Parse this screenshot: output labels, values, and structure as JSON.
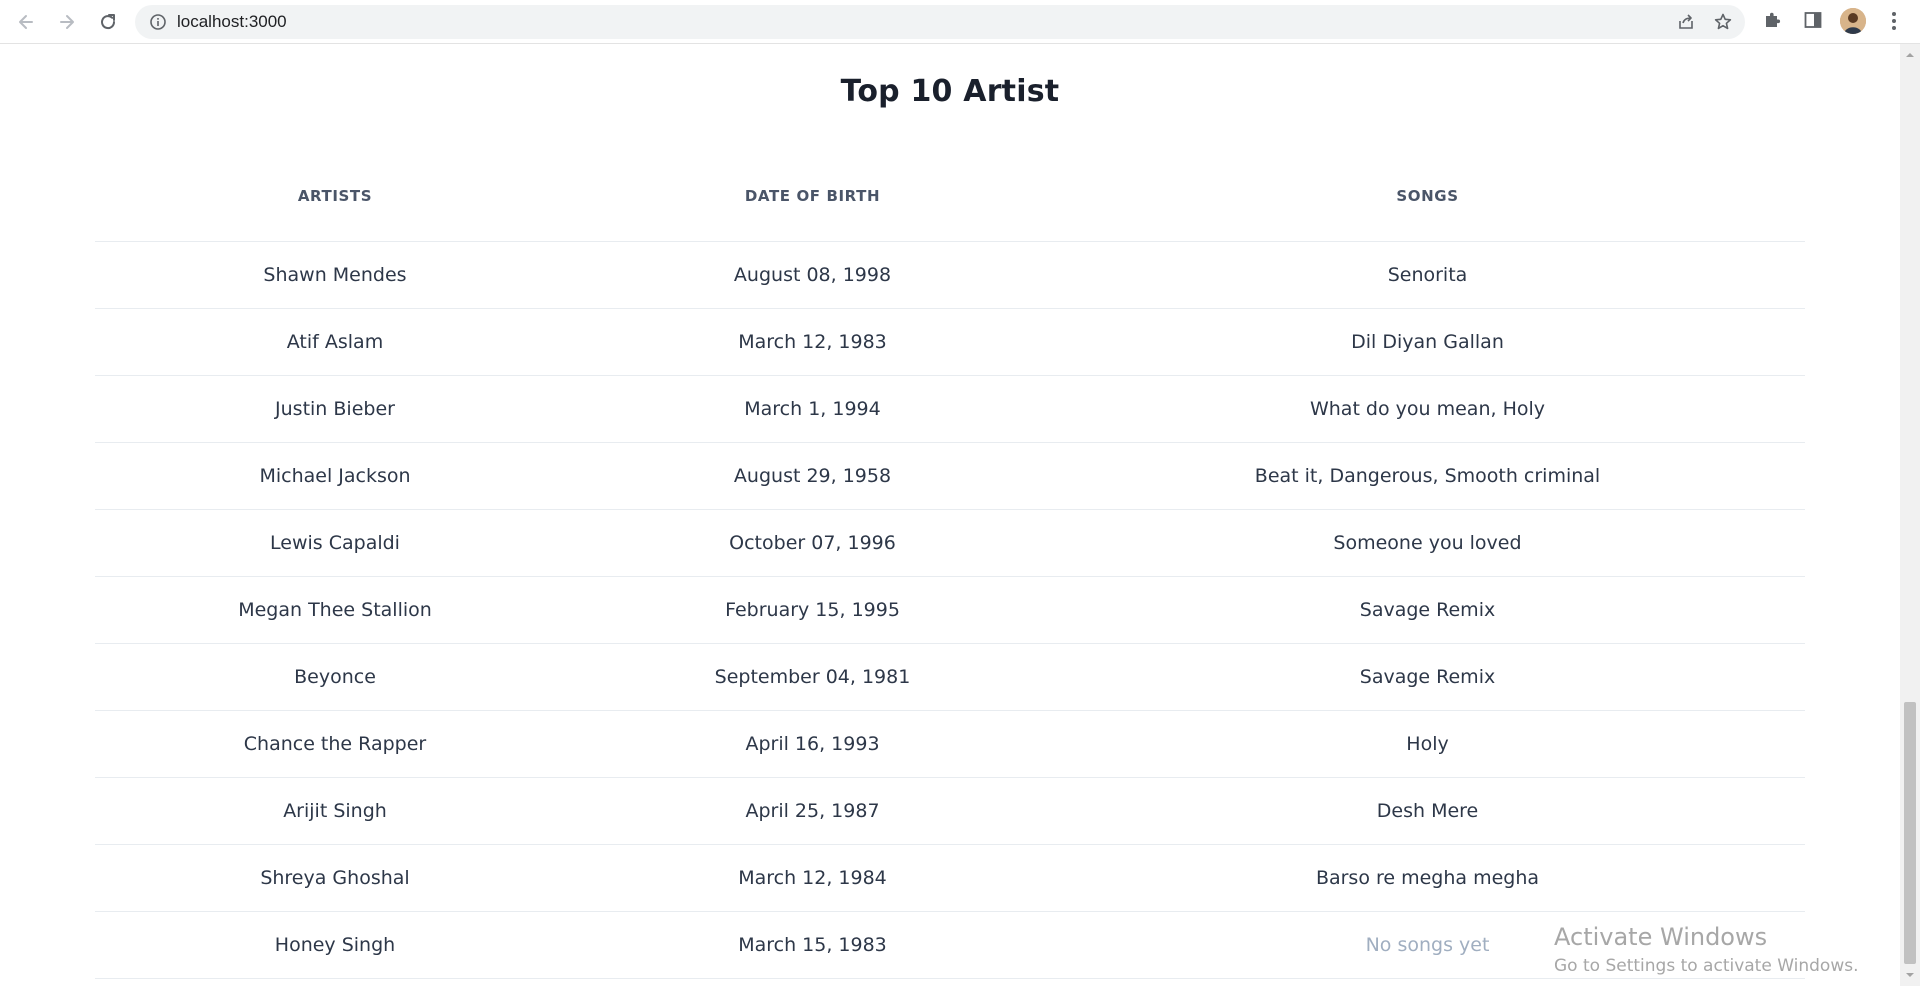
{
  "browser": {
    "url": "localhost:3000"
  },
  "page": {
    "title": "Top 10 Artist"
  },
  "table": {
    "headers": [
      "ARTISTS",
      "DATE OF BIRTH",
      "SONGS"
    ],
    "rows": [
      {
        "artist": "Shawn Mendes",
        "dob": "August 08, 1998",
        "songs": "Senorita",
        "muted": false
      },
      {
        "artist": "Atif Aslam",
        "dob": "March 12, 1983",
        "songs": "Dil Diyan Gallan",
        "muted": false
      },
      {
        "artist": "Justin Bieber",
        "dob": "March 1, 1994",
        "songs": "What do you mean, Holy",
        "muted": false
      },
      {
        "artist": "Michael Jackson",
        "dob": "August 29, 1958",
        "songs": "Beat it, Dangerous, Smooth criminal",
        "muted": false
      },
      {
        "artist": "Lewis Capaldi",
        "dob": "October 07, 1996",
        "songs": "Someone you loved",
        "muted": false
      },
      {
        "artist": "Megan Thee Stallion",
        "dob": "February 15, 1995",
        "songs": "Savage Remix",
        "muted": false
      },
      {
        "artist": "Beyonce",
        "dob": "September 04, 1981",
        "songs": "Savage Remix",
        "muted": false
      },
      {
        "artist": "Chance the Rapper",
        "dob": "April 16, 1993",
        "songs": "Holy",
        "muted": false
      },
      {
        "artist": "Arijit Singh",
        "dob": "April 25, 1987",
        "songs": "Desh Mere",
        "muted": false
      },
      {
        "artist": "Shreya Ghoshal",
        "dob": "March 12, 1984",
        "songs": "Barso re megha megha",
        "muted": false
      },
      {
        "artist": "Honey Singh",
        "dob": "March 15, 1983",
        "songs": "No songs yet",
        "muted": true
      }
    ]
  },
  "watermark": {
    "title": "Activate Windows",
    "subtitle": "Go to Settings to activate Windows."
  },
  "icons": {
    "back": "back-arrow-icon",
    "forward": "forward-arrow-icon",
    "reload": "reload-icon",
    "info": "info-icon",
    "share": "share-icon",
    "star": "star-icon",
    "extensions": "puzzle-icon",
    "side_panel": "side-panel-icon",
    "menu": "kebab-menu-icon"
  }
}
